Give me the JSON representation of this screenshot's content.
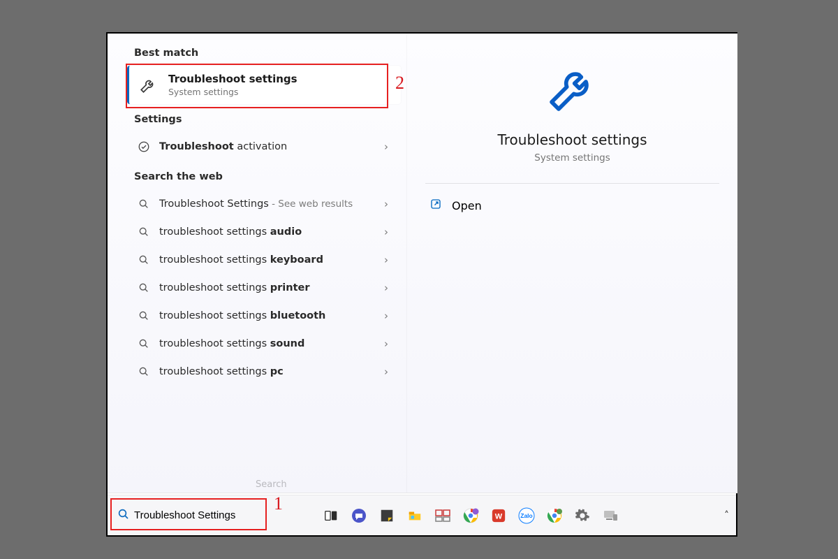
{
  "sections": {
    "best_match": "Best match",
    "settings": "Settings",
    "web": "Search the web"
  },
  "best_match_item": {
    "title": "Troubleshoot settings",
    "subtitle": "System settings"
  },
  "settings_results": [
    {
      "prefix_bold": "Troubleshoot",
      "rest": " activation"
    }
  ],
  "web_results": [
    {
      "prefix": "Troubleshoot Settings",
      "suffix": " - See web results",
      "is_lead": true
    },
    {
      "prefix": "troubleshoot settings ",
      "bold_suffix": "audio"
    },
    {
      "prefix": "troubleshoot settings ",
      "bold_suffix": "keyboard"
    },
    {
      "prefix": "troubleshoot settings ",
      "bold_suffix": "printer"
    },
    {
      "prefix": "troubleshoot settings ",
      "bold_suffix": "bluetooth"
    },
    {
      "prefix": "troubleshoot settings ",
      "bold_suffix": "sound"
    },
    {
      "prefix": "troubleshoot settings ",
      "bold_suffix": "pc"
    }
  ],
  "detail": {
    "title": "Troubleshoot settings",
    "subtitle": "System settings",
    "open_label": "Open"
  },
  "search_input": {
    "value": "Troubleshoot Settings"
  },
  "faint_hint": "Search",
  "annotations": {
    "one": "1",
    "two": "2"
  },
  "taskbar_icons": [
    "task-view",
    "chat",
    "notes",
    "file-explorer",
    "snip",
    "chrome-profile",
    "wps",
    "zalo",
    "chrome",
    "settings-gear",
    "device"
  ]
}
